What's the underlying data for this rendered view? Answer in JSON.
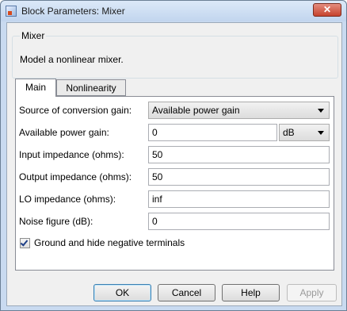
{
  "window": {
    "title": "Block Parameters: Mixer",
    "close_glyph": "✕"
  },
  "group": {
    "legend": "Mixer",
    "description": "Model a nonlinear mixer."
  },
  "tabs": [
    {
      "label": "Main",
      "active": true
    },
    {
      "label": "Nonlinearity",
      "active": false
    }
  ],
  "form": {
    "source_label": "Source of conversion gain:",
    "source_value": "Available power gain",
    "gain_label": "Available power gain:",
    "gain_value": "0",
    "gain_unit": "dB",
    "input_imp_label": "Input impedance (ohms):",
    "input_imp_value": "50",
    "output_imp_label": "Output impedance (ohms):",
    "output_imp_value": "50",
    "lo_imp_label": "LO impedance (ohms):",
    "lo_imp_value": "inf",
    "noise_label": "Noise figure (dB):",
    "noise_value": "0",
    "ground_label": "Ground and hide negative terminals",
    "ground_checked": true
  },
  "buttons": {
    "ok": "OK",
    "cancel": "Cancel",
    "help": "Help",
    "apply": "Apply"
  },
  "icons": {
    "app": "block-parameters-icon",
    "close": "close-icon",
    "dropdown": "chevron-down-icon",
    "check": "checkmark-icon"
  }
}
